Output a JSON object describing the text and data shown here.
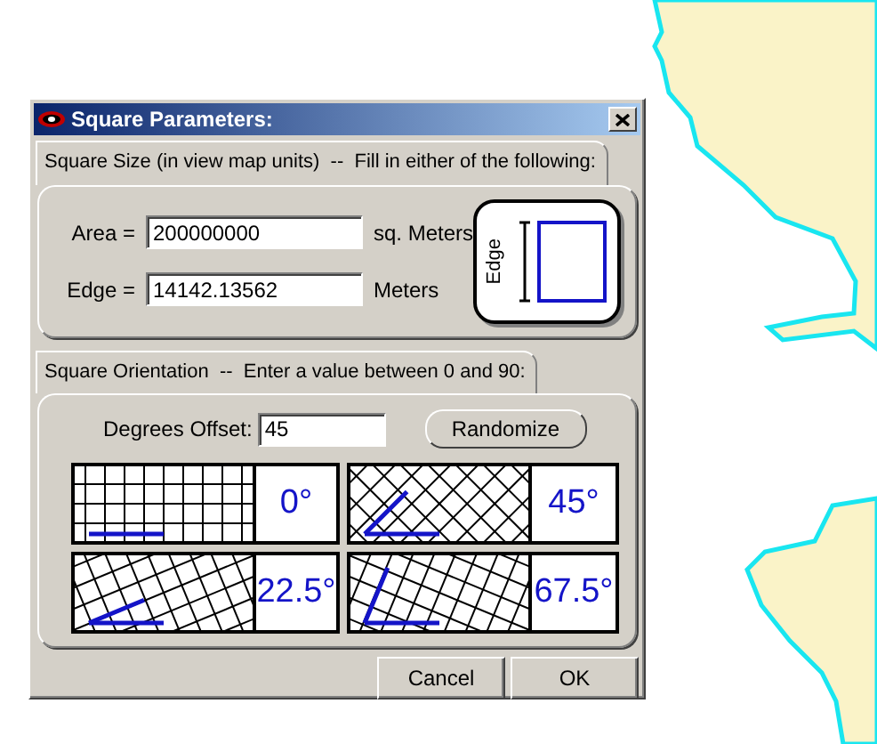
{
  "window": {
    "title": "Square Parameters:"
  },
  "size_group": {
    "tab": "Square Size (in view map units)  --  Fill in either of the following:",
    "fields": [
      {
        "label": "Area =",
        "value": "200000000",
        "unit": "sq. Meters"
      },
      {
        "label": "Edge =",
        "value": "14142.13562",
        "unit": "Meters"
      }
    ],
    "diagram_label": "Edge"
  },
  "orientation_group": {
    "tab": "Square Orientation  --  Enter a value between 0 and 90:",
    "offset_label": "Degrees Offset:",
    "offset_value": "45",
    "randomize": "Randomize",
    "presets": [
      {
        "label": "0°"
      },
      {
        "label": "45°"
      },
      {
        "label": "22.5°"
      },
      {
        "label": "67.5°"
      }
    ]
  },
  "buttons": [
    "Cancel",
    "OK"
  ]
}
